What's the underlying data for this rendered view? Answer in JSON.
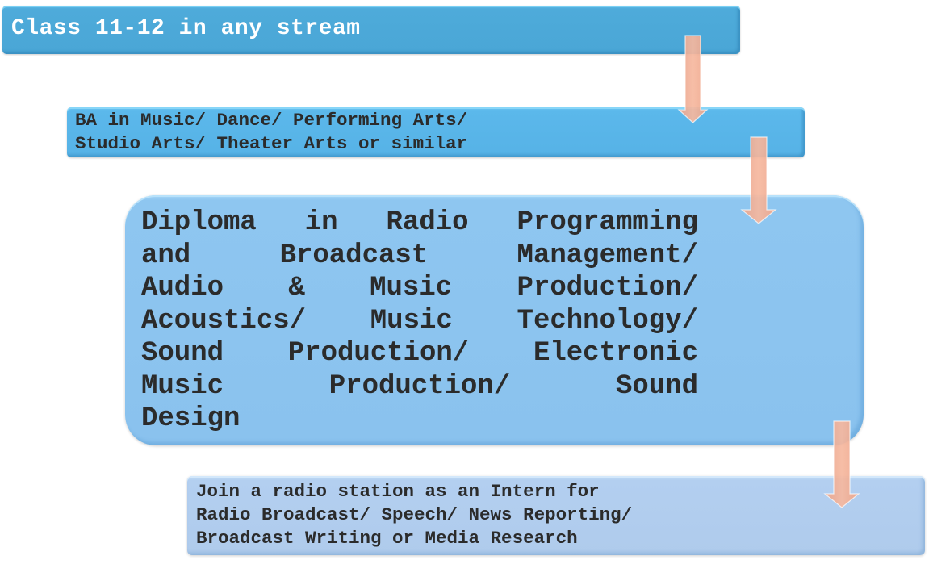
{
  "diagram": {
    "type": "flowchart",
    "direction": "top-to-bottom",
    "colors": {
      "step1_fill": "#4eabda",
      "step2_fill": "#5bb8eb",
      "step3_fill": "#8ec6f0",
      "step4_fill": "#b3cff0",
      "arrow_fill": "#f4b49a",
      "step1_text": "#ffffff",
      "step_text": "#2b2b2b"
    },
    "steps": [
      {
        "id": "step-1",
        "text": "Class 11-12 in any stream"
      },
      {
        "id": "step-2",
        "lines": [
          "BA in Music/ Dance/ Performing Arts/",
          "Studio Arts/ Theater Arts or similar"
        ]
      },
      {
        "id": "step-3",
        "lines": [
          [
            "Diploma",
            "in",
            "Radio",
            "Programming"
          ],
          [
            "and",
            "Broadcast",
            "Management/"
          ],
          [
            "Audio",
            "&",
            "Music",
            "Production/"
          ],
          [
            "Acoustics/",
            "Music",
            "Technology/"
          ],
          [
            "Sound",
            "Production/",
            "Electronic"
          ],
          [
            "Music",
            "Production/",
            "Sound"
          ],
          [
            "Design"
          ]
        ]
      },
      {
        "id": "step-4",
        "lines": [
          "Join a radio station as an Intern for",
          "Radio Broadcast/ Speech/ News Reporting/",
          "Broadcast Writing or Media Research"
        ]
      }
    ],
    "connections": [
      {
        "from": "step-1",
        "to": "step-2"
      },
      {
        "from": "step-2",
        "to": "step-3"
      },
      {
        "from": "step-3",
        "to": "step-4"
      }
    ]
  }
}
